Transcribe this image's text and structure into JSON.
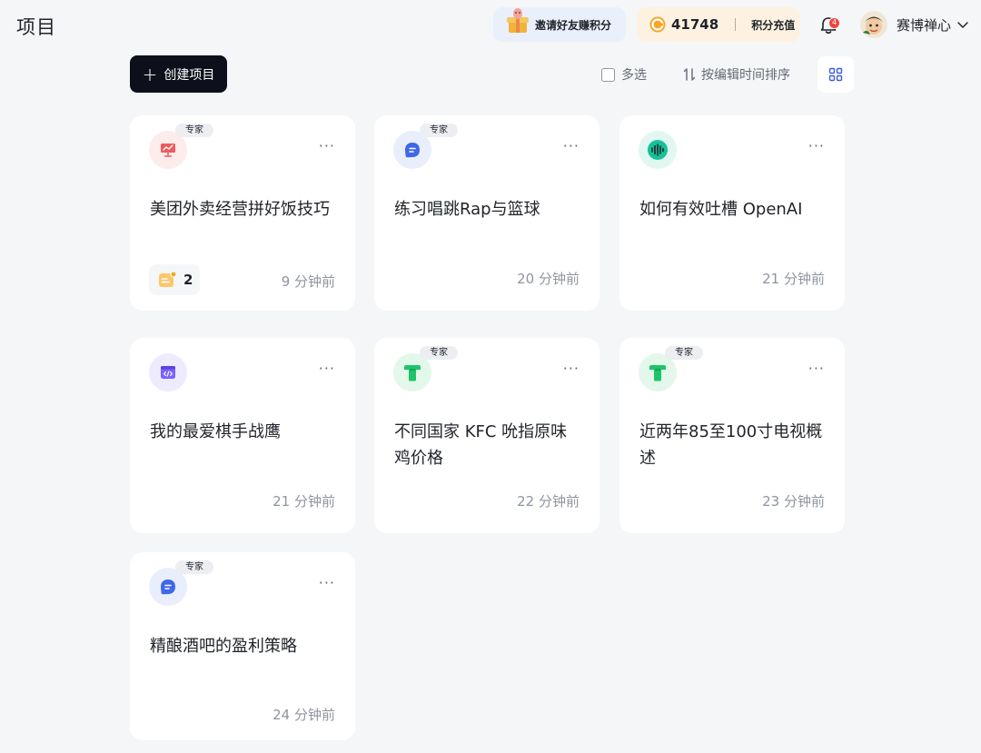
{
  "header": {
    "title": "项目",
    "invite_label": "邀请好友赚积分",
    "points_value": "41748",
    "recharge_label": "积分充值",
    "notification_count": "4",
    "user_name": "赛博禅心"
  },
  "toolbar": {
    "create_label": "创建项目",
    "multi_select_label": "多选",
    "sort_label": "按编辑时间排序"
  },
  "cards": [
    {
      "title": "美团外卖经营拼好饭技巧",
      "time": "9 分钟前",
      "tag": "专家",
      "icon": "presentation-icon",
      "icon_bg": "#fdecec",
      "doc_count": "2"
    },
    {
      "title": "练习唱跳Rap与篮球",
      "time": "20 分钟前",
      "tag": "专家",
      "icon": "chat-bubble-icon",
      "icon_bg": "#e8eefc"
    },
    {
      "title": "如何有效吐槽 OpenAI",
      "time": "21 分钟前",
      "tag": "",
      "icon": "soundwave-icon",
      "icon_bg": "#e2f7f1"
    },
    {
      "title": "我的最爱棋手战鹰",
      "time": "21 分钟前",
      "tag": "",
      "icon": "code-window-icon",
      "icon_bg": "#eeebfd"
    },
    {
      "title": "不同国家 KFC 吮指原味鸡价格",
      "time": "22 分钟前",
      "tag": "专家",
      "icon": "t-shirt-icon",
      "icon_bg": "#e3f7ea"
    },
    {
      "title": "近两年85至100寸电视概述",
      "time": "23 分钟前",
      "tag": "专家",
      "icon": "t-shirt-icon",
      "icon_bg": "#e3f7ea"
    },
    {
      "title": "精酿酒吧的盈利策略",
      "time": "24 分钟前",
      "tag": "专家",
      "icon": "chat-bubble-icon",
      "icon_bg": "#e8eefc"
    }
  ],
  "colors": {
    "create_button_bg": "#0d0f1a",
    "expert_tag_bg": "#eceef2",
    "badge_red": "#f0463c"
  }
}
